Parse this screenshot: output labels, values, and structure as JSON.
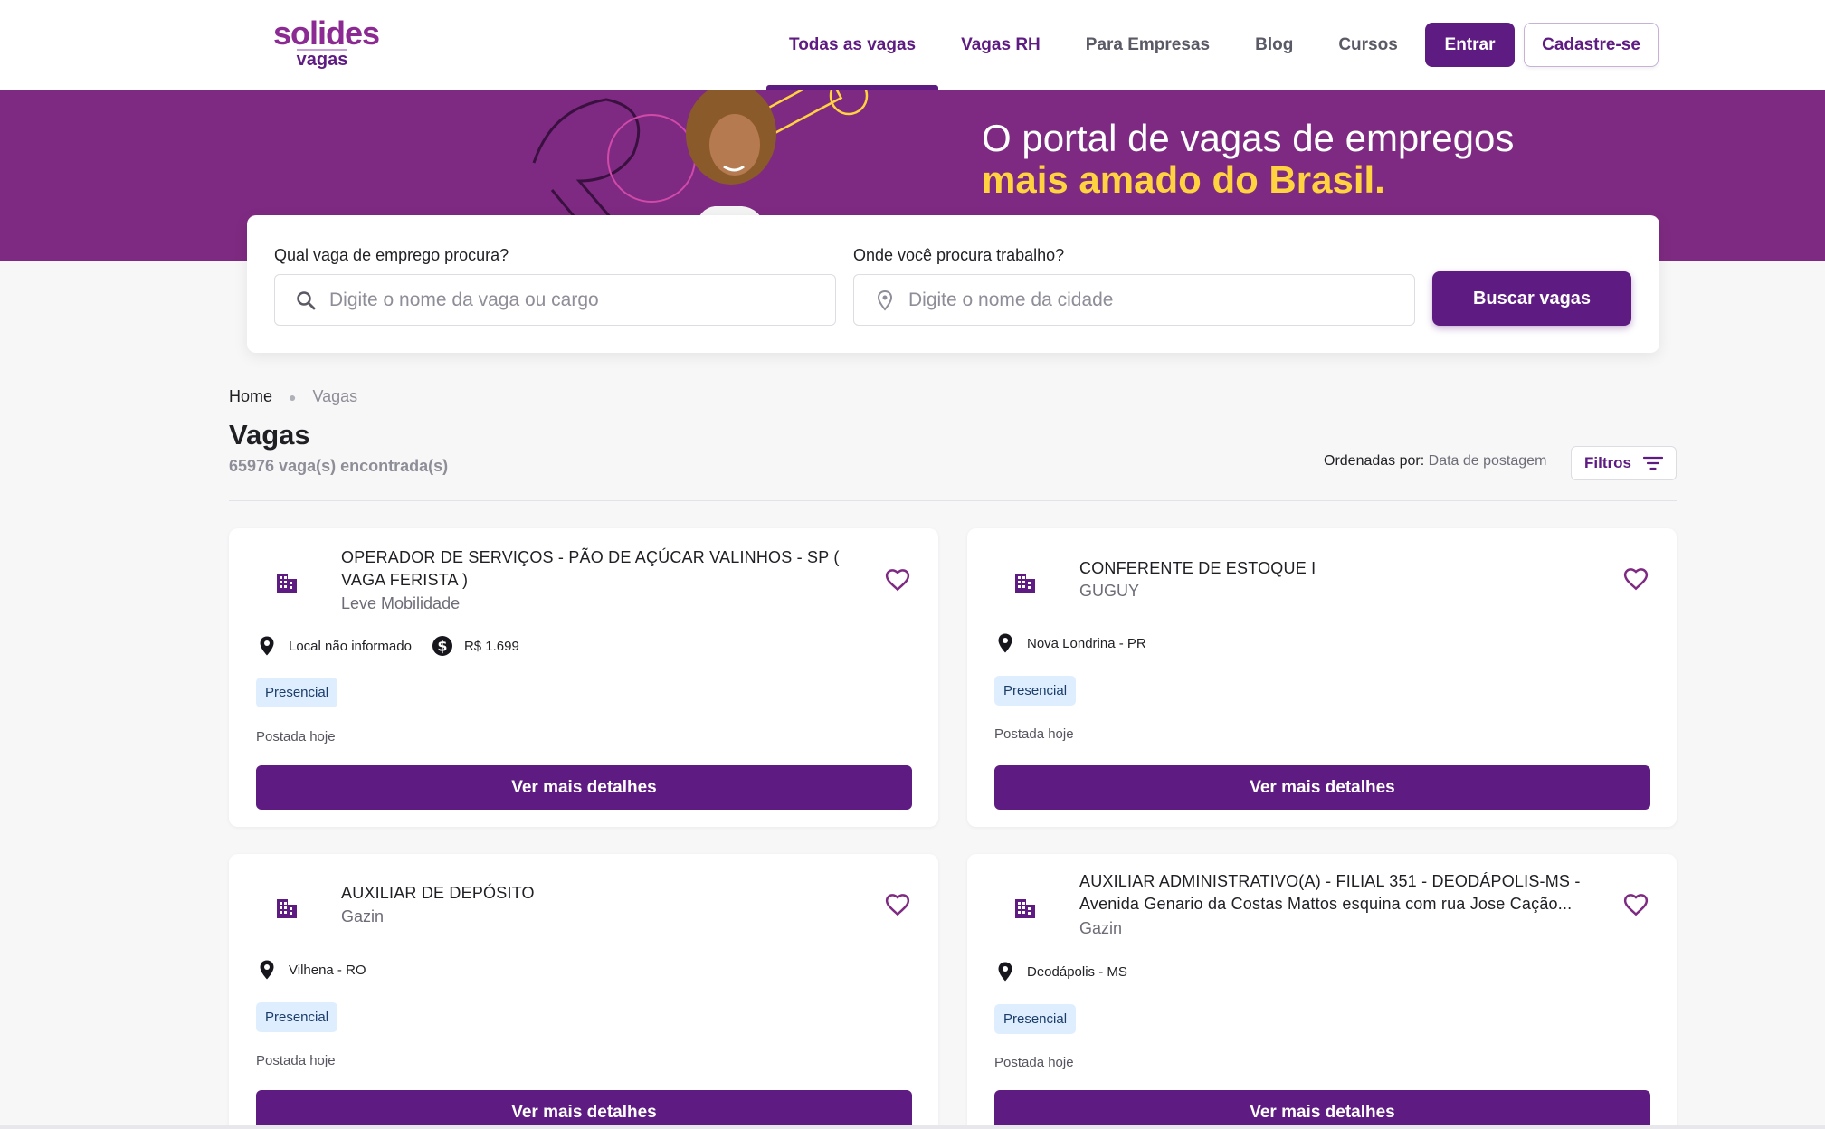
{
  "brand": {
    "name": "solides",
    "sub": "vagas",
    "primary": "#5e1b82",
    "hero_bg": "#7e2a82",
    "highlight": "#ffd23f"
  },
  "nav": {
    "items": [
      {
        "label": "Todas as vagas",
        "active": true
      },
      {
        "label": "Vagas RH",
        "active": false
      },
      {
        "label": "Para Empresas",
        "active": false
      },
      {
        "label": "Blog",
        "active": false
      },
      {
        "label": "Cursos",
        "active": false
      }
    ],
    "login_label": "Entrar",
    "signup_label": "Cadastre-se"
  },
  "hero": {
    "line1": "O portal de vagas de empregos",
    "line2": "mais amado do Brasil."
  },
  "search": {
    "job_label": "Qual vaga de emprego procura?",
    "job_placeholder": "Digite o nome da vaga ou cargo",
    "city_label": "Onde você procura trabalho?",
    "city_placeholder": "Digite o nome da cidade",
    "button_label": "Buscar vagas",
    "job_icon": "search-icon",
    "city_icon": "map-pin-icon"
  },
  "breadcrumb": {
    "home": "Home",
    "current": "Vagas"
  },
  "listing": {
    "title": "Vagas",
    "count": "65976 vaga(s) encontrada(s)",
    "sort_label": "Ordenadas por:",
    "sort_value": "Data de postagem",
    "filter_label": "Filtros"
  },
  "jobs": [
    {
      "title": "OPERADOR DE SERVIÇOS - PÃO DE AÇÚCAR VALINHOS - SP ( VAGA FERISTA )",
      "company": "Leve Mobilidade",
      "location": "Local não informado",
      "salary": "R$ 1.699",
      "mode": "Presencial",
      "posted": "Postada hoje",
      "cta": "Ver mais detalhes"
    },
    {
      "title": "CONFERENTE DE ESTOQUE I",
      "company": "GUGUY",
      "location": "Nova Londrina - PR",
      "salary": "",
      "mode": "Presencial",
      "posted": "Postada hoje",
      "cta": "Ver mais detalhes"
    },
    {
      "title": "AUXILIAR DE DEPÓSITO",
      "company": "Gazin",
      "location": "Vilhena - RO",
      "salary": "",
      "mode": "Presencial",
      "posted": "Postada hoje",
      "cta": "Ver mais detalhes"
    },
    {
      "title": "AUXILIAR ADMINISTRATIVO(A) - FILIAL 351 - DEODÁPOLIS-MS - Avenida Genario da Costas Mattos esquina com rua Jose Cação...",
      "company": "Gazin",
      "location": "Deodápolis - MS",
      "salary": "",
      "mode": "Presencial",
      "posted": "Postada hoje",
      "cta": "Ver mais detalhes"
    }
  ]
}
